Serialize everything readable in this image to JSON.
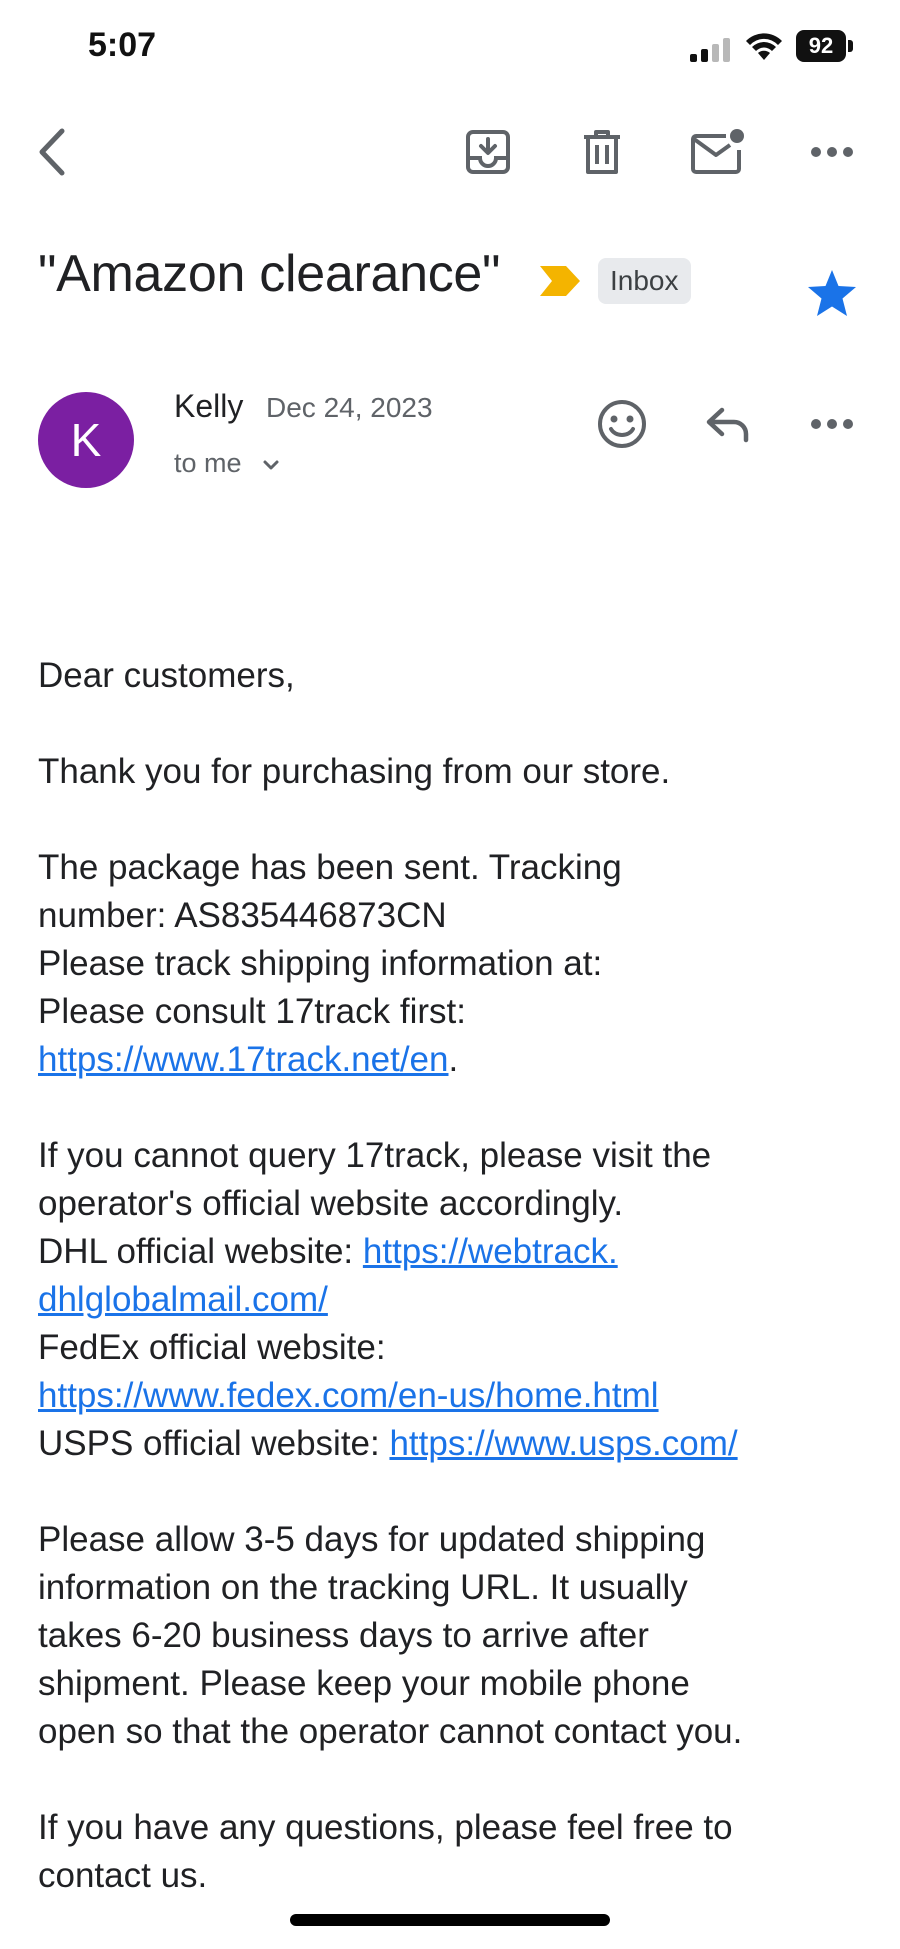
{
  "status_bar": {
    "time": "5:07",
    "battery": "92"
  },
  "email": {
    "subject": "\"Amazon clearance\"",
    "label": "Inbox",
    "starred": true,
    "sender": {
      "initial": "K",
      "name": "Kelly",
      "date": "Dec 24, 2023",
      "recipient": "to me",
      "avatar_color": "#7b1fa2"
    },
    "body": {
      "greeting": "Dear customers,",
      "thanks": "Thank you for purchasing from our store.",
      "p3_line1": "The package has been sent. Tracking",
      "p3_line2": "number:  AS835446873CN",
      "p3_line3": "Please track shipping information at:",
      "p3_line4": "Please consult 17track first:",
      "link_17track": "https://www.17track.net/en",
      "p3_period": ".",
      "p4_line1": "If you cannot query 17track, please visit the",
      "p4_line2": "operator's official website accordingly.",
      "dhl_label": "DHL official website: ",
      "dhl_link_part1": "https://webtrack.",
      "dhl_link_part2": "dhlglobalmail.com/",
      "fedex_label": "FedEx official website:",
      "fedex_link": "https://www.fedex.com/en-us/home.html",
      "usps_label": "USPS official website: ",
      "usps_link": "https://www.usps.com/",
      "p5_line1": "Please allow 3-5 days for updated shipping",
      "p5_line2": "information on the tracking URL. It usually",
      "p5_line3": "takes 6-20 business days to arrive after",
      "p5_line4": "shipment. Please keep your mobile phone",
      "p5_line5": "open so that the operator cannot contact you.",
      "p6_line1": "If you have any questions, please feel free to",
      "p6_line2": "contact us."
    }
  },
  "icons": {
    "back": "back-arrow-icon",
    "archive": "archive-icon",
    "delete": "trash-icon",
    "mark_unread": "mark-unread-icon",
    "more": "more-icon",
    "react": "emoji-icon",
    "reply": "reply-icon",
    "importance": "importance-marker-icon",
    "star": "star-icon"
  },
  "colors": {
    "link": "#1a73e8",
    "star": "#1a73e8",
    "importance": "#f4b400",
    "label_bg": "#e8eaed"
  }
}
